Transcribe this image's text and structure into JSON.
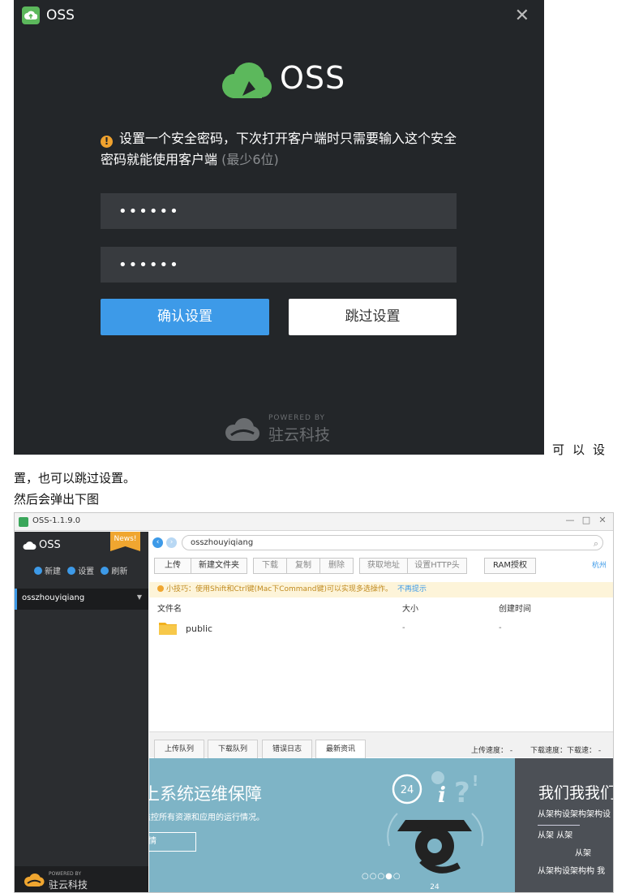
{
  "dialog": {
    "app_name": "OSS",
    "brand_name": "OSS",
    "notice_text": "设置一个安全密码，下次打开客户端时只需要输入这个安全密码就能使用客户端",
    "notice_hint": "(最少6位)",
    "password_value": "••••••",
    "confirm_password_value": "••••••",
    "confirm_label": "确认设置",
    "skip_label": "跳过设置",
    "powered_small": "POWERED BY",
    "powered_company": "驻云科技",
    "colors": {
      "background": "#232629",
      "accent": "#3d9ae8",
      "brand": "#5cb85c"
    }
  },
  "doc": {
    "tail_text": "可以设",
    "line1": "置，也可以跳过设置。",
    "line2": "然后会弹出下图"
  },
  "app": {
    "window_title": "OSS-1.1.9.0",
    "sidebar": {
      "name": "OSS",
      "news_badge": "News!",
      "actions": [
        "新建",
        "设置",
        "刷新"
      ],
      "bucket": "osszhouyiqiang",
      "footer_small": "POWERED BY",
      "footer_company": "驻云科技"
    },
    "path": "osszhouyiqiang",
    "toolbar": [
      "上传",
      "新建文件夹",
      "下载",
      "复制",
      "删除",
      "获取地址",
      "设置HTTP头",
      "RAM授权"
    ],
    "region": "杭州",
    "tip": {
      "text": "小技巧：使用Shift和Ctrl键(Mac下Command键)可以实现多选操作。",
      "link": "不再提示"
    },
    "columns": [
      "文件名",
      "大小",
      "创建时间"
    ],
    "files": [
      {
        "name": "public",
        "size": "-",
        "created": "-"
      }
    ],
    "tabs": [
      "上传队列",
      "下载队列",
      "错误日志",
      "最新资讯"
    ],
    "upload_speed": "上传速度：  -",
    "download_speed": "下载速度：下载速：  -",
    "banner": {
      "title": "上系统运维保障",
      "subtitle": "监控所有资源和应用的运行情况。",
      "button": "情",
      "badge": "24",
      "dots": "○○○●○"
    },
    "panel": {
      "title": "我们我我们",
      "line1": "从架构设架构架构设",
      "line2": "从架        从架",
      "line3": "从架",
      "line4": "从架构设架构构 我"
    }
  }
}
